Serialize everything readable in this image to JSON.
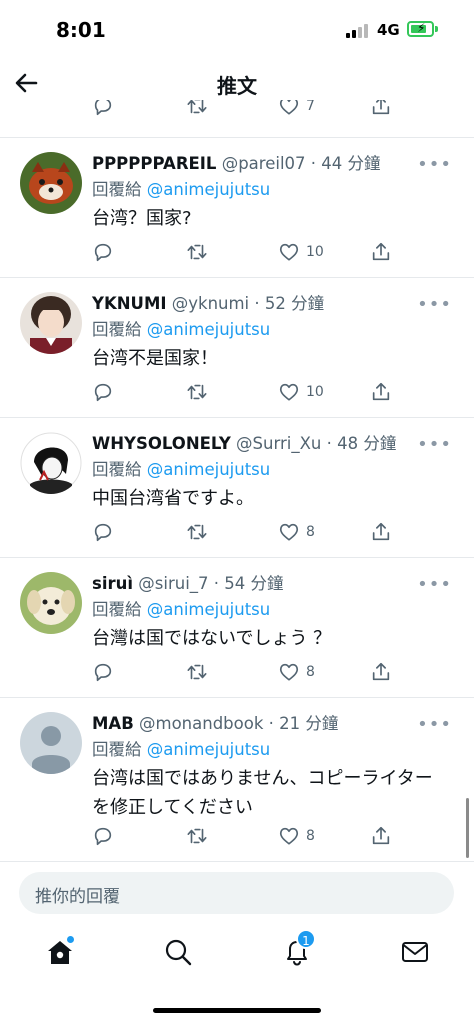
{
  "status_bar": {
    "time": "8:01",
    "network": "4G"
  },
  "header": {
    "title": "推文"
  },
  "reply_prefix": "回覆給",
  "partial_counts": {
    "like": "7"
  },
  "tweets": [
    {
      "name": "PPPPPPAREIL",
      "handle": "@pareil07",
      "time": "44 分鐘",
      "reply_to": "@animejujutsu",
      "text": "台湾？国家?",
      "like_count": "10"
    },
    {
      "name": "YKNUMI",
      "handle": "@yknumi",
      "time": "52 分鐘",
      "reply_to": "@animejujutsu",
      "text": "台湾不是国家！",
      "like_count": "10"
    },
    {
      "name": "WHYSOLONELY",
      "handle": "@Surri_Xu",
      "time": "48 分鐘",
      "reply_to": "@animejujutsu",
      "text": "中国台湾省ですよ。",
      "like_count": "8"
    },
    {
      "name": "siruì",
      "handle": "@sirui_7",
      "time": "54 分鐘",
      "reply_to": "@animejujutsu",
      "text": "台灣は国ではないでしょう ？",
      "like_count": "8"
    },
    {
      "name": "MAB",
      "handle": "@monandbook",
      "time": "21 分鐘",
      "reply_to": "@animejujutsu",
      "text_line1": "台湾は国ではありません、コピーライター",
      "text_line2": "を修正してください",
      "like_count": "8"
    }
  ],
  "reply_box": {
    "placeholder": "推你的回覆"
  },
  "tabbar": {
    "notification_count": "1"
  },
  "colors": {
    "accent": "#1d9bf0",
    "text_secondary": "#536471",
    "like_outline": "#536471",
    "battery": "#34c759"
  },
  "icons": [
    "back-arrow-icon",
    "reply-icon",
    "retweet-icon",
    "like-icon",
    "share-icon",
    "home-icon",
    "search-icon",
    "bell-icon",
    "mail-icon",
    "more-icon"
  ]
}
